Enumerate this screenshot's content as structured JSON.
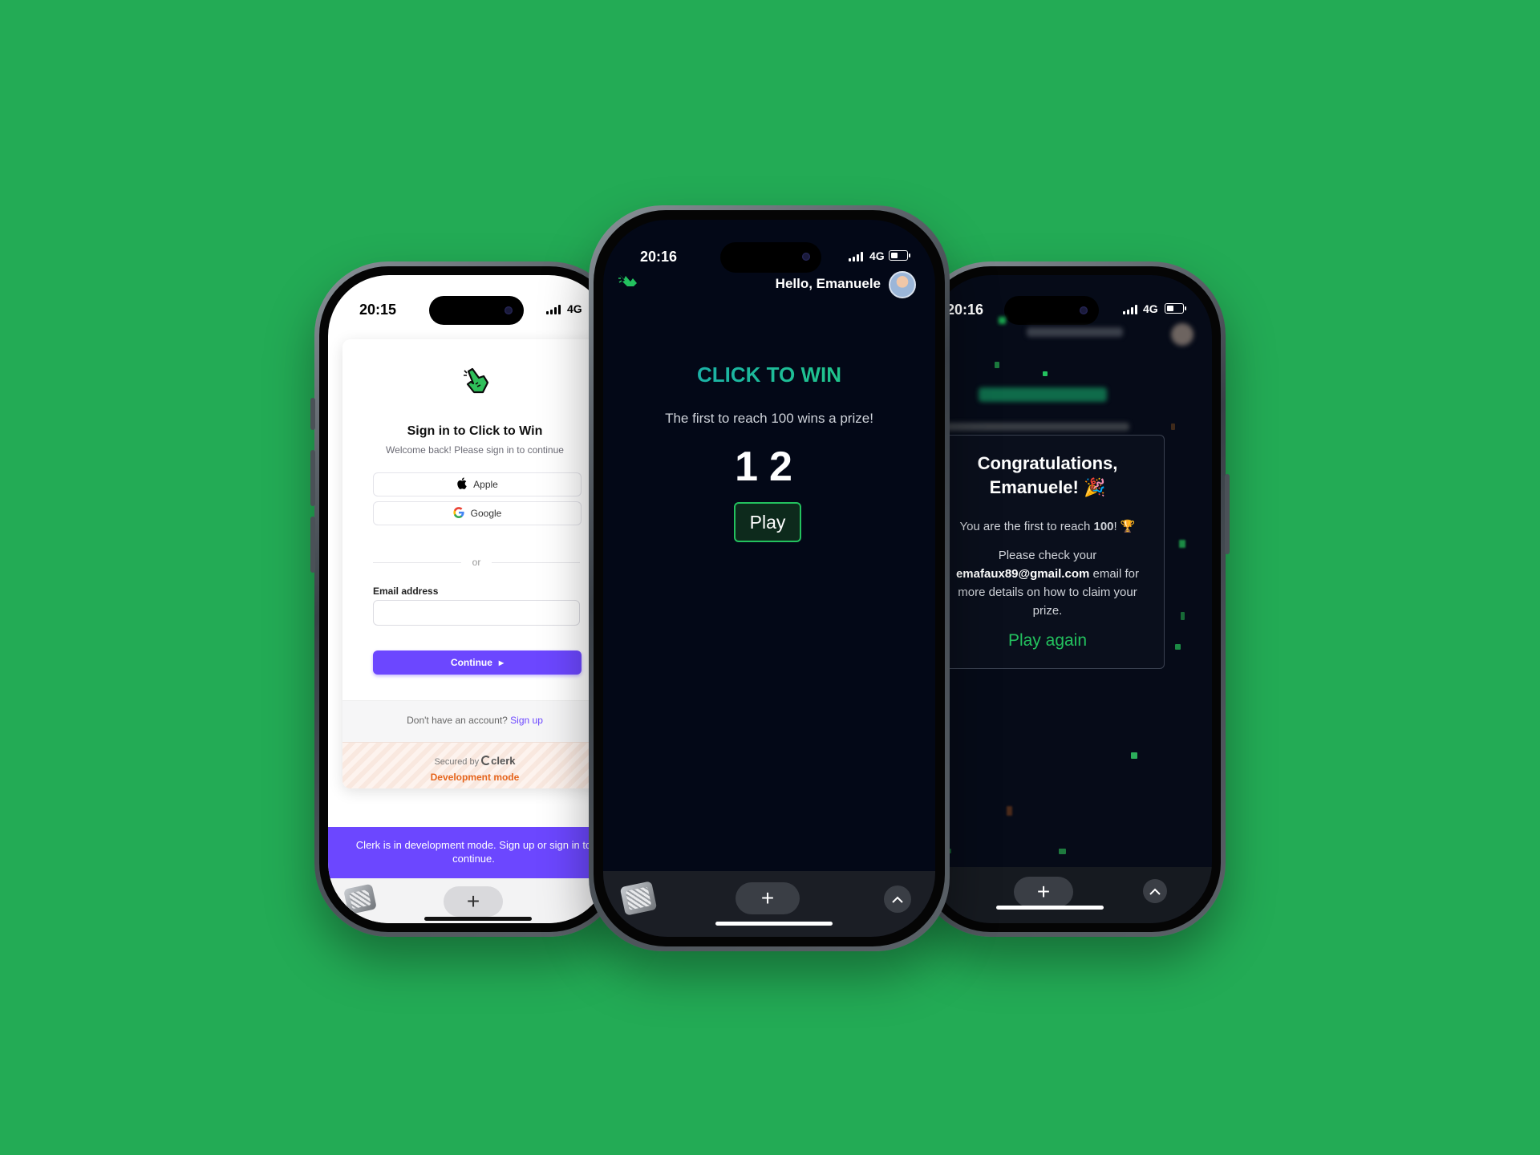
{
  "left_phone": {
    "time": "20:15",
    "network": "4G",
    "card": {
      "title": "Sign in to Click to Win",
      "subtitle": "Welcome back! Please sign in to continue",
      "apple_label": "Apple",
      "google_label": "Google",
      "or_label": "or",
      "email_label": "Email address",
      "email_value": "",
      "continue_label": "Continue",
      "footer_text": "Don't have an account?",
      "signup_link": "Sign up",
      "secured_by": "Secured by",
      "clerk_brand": "clerk",
      "dev_mode": "Development mode"
    },
    "banner": "Clerk is in development mode. Sign up or sign in to continue."
  },
  "center_phone": {
    "time": "20:16",
    "network": "4G",
    "greeting": "Hello, Emanuele",
    "title": "CLICK TO WIN",
    "subtitle": "The first to reach 100 wins a prize!",
    "score": "12",
    "play_label": "Play"
  },
  "right_phone": {
    "time": "20:16",
    "network": "4G",
    "congrats_line1": "Congratulations,",
    "congrats_line2": "Emanuele! 🎉",
    "reach_prefix": "You are the first to reach",
    "reach_value": "100",
    "reach_suffix": "! 🏆",
    "check_prefix": "Please check your",
    "email": "emafaux89@gmail.com",
    "check_suffix": "email for more details on how to claim your prize.",
    "play_again": "Play again"
  },
  "colors": {
    "background": "#23ab55",
    "accent_green": "#23c15e",
    "clerk_purple": "#6c47ff",
    "dev_orange": "#e5641c"
  },
  "icons": [
    "hand-pointer-icon",
    "apple-icon",
    "google-icon",
    "plus-icon",
    "chevron-up-icon",
    "signal-icon",
    "battery-icon"
  ]
}
